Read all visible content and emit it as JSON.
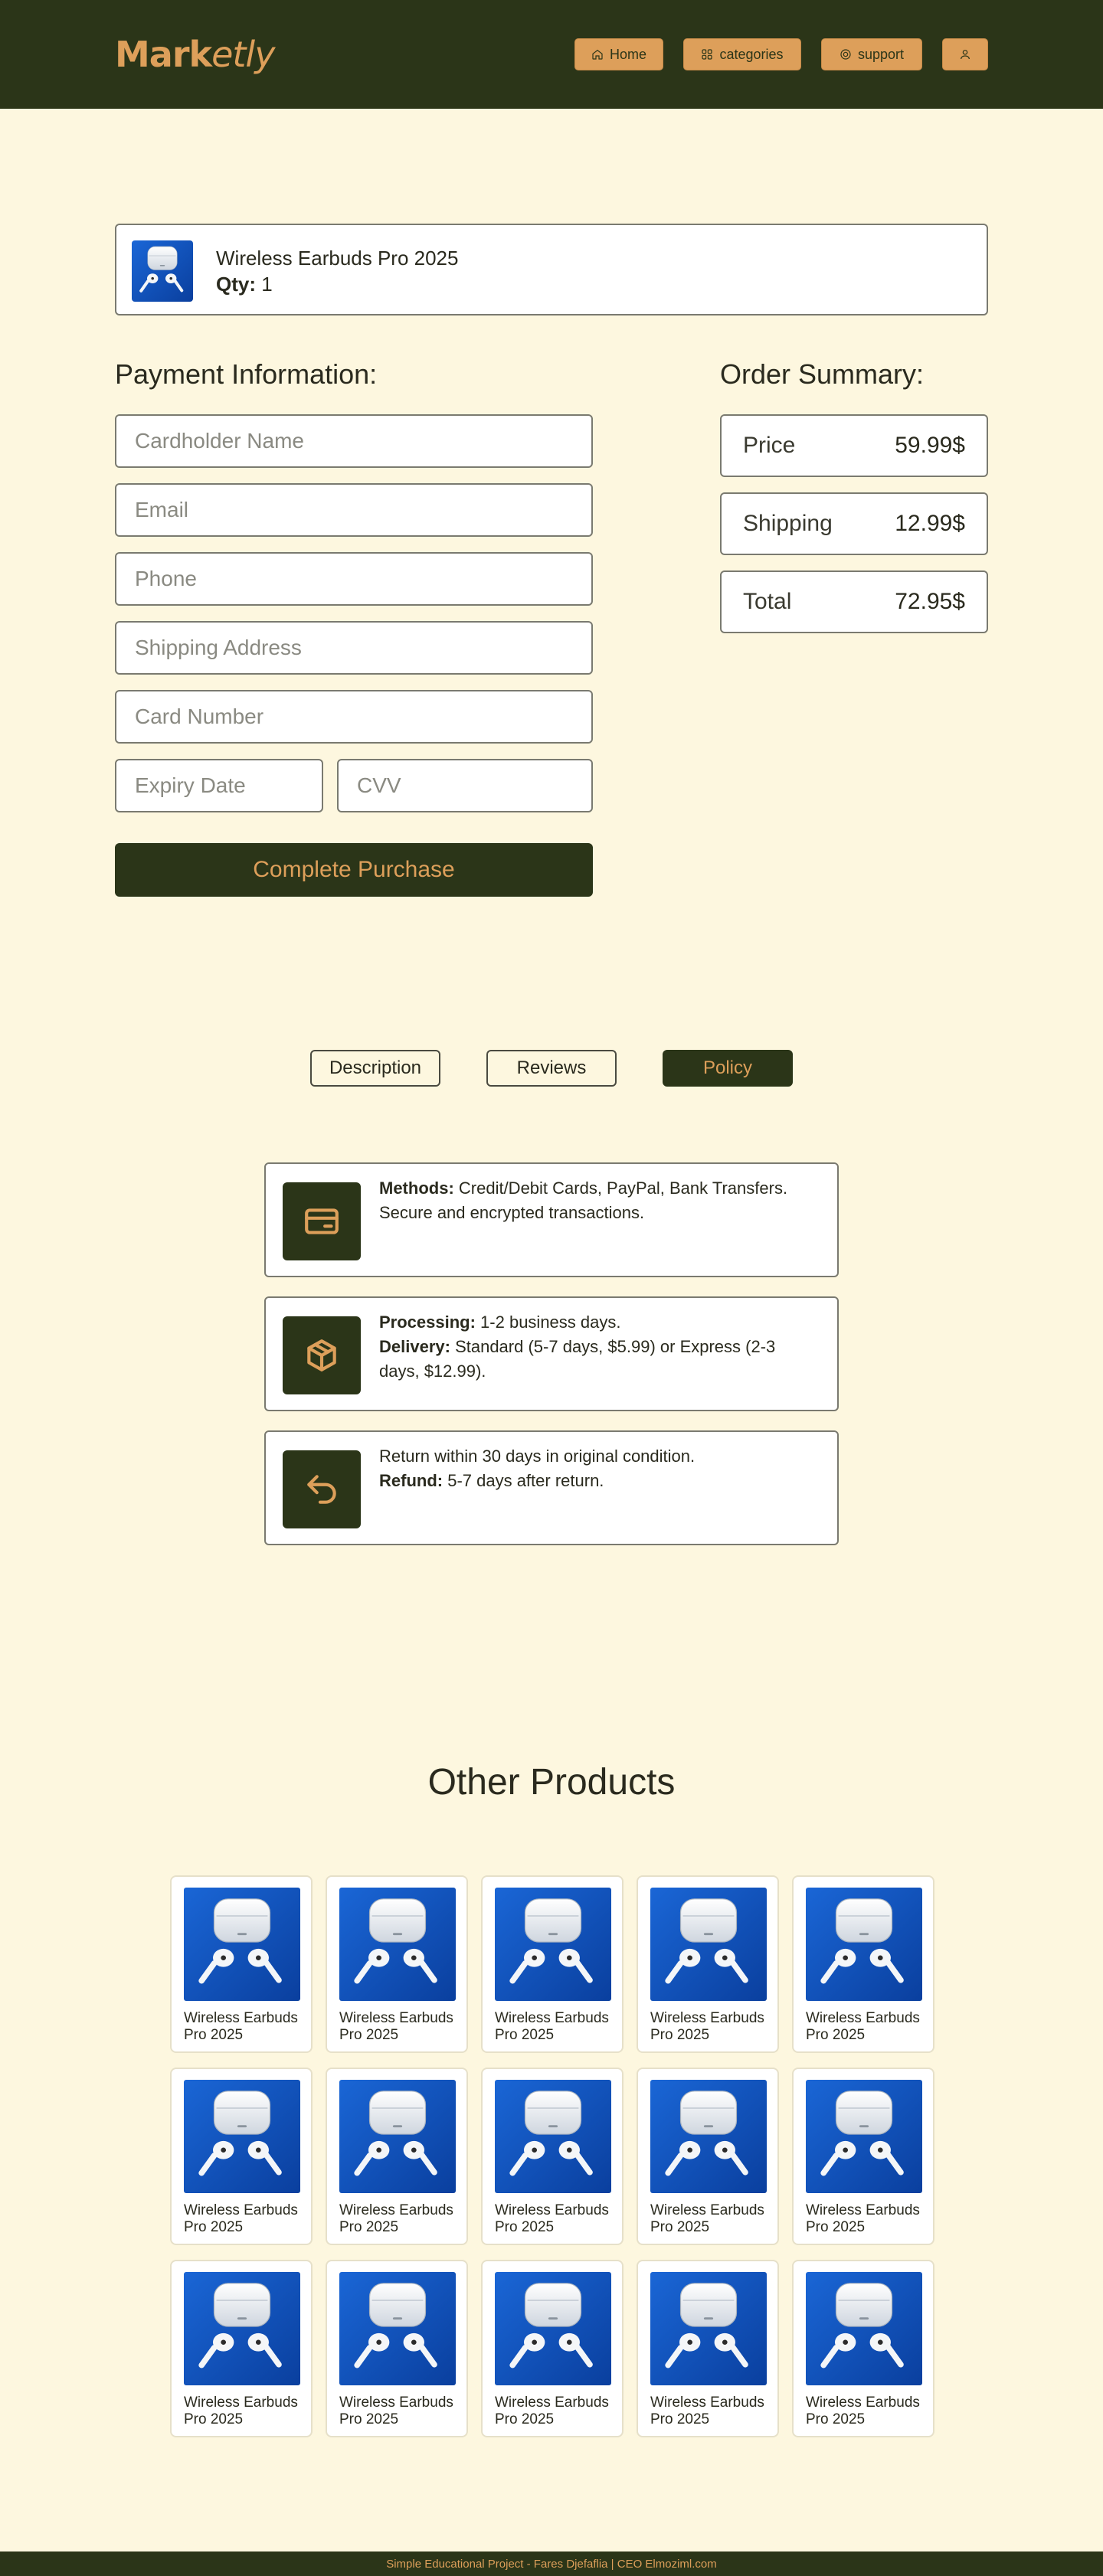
{
  "header": {
    "logo_bold": "Mark",
    "logo_italic": "etly",
    "nav": {
      "home": "Home",
      "categories": "categories",
      "support": "support"
    }
  },
  "cart_item": {
    "name": "Wireless Earbuds Pro 2025",
    "qty_label": "Qty:",
    "qty_value": "1"
  },
  "payment": {
    "title": "Payment Information:",
    "placeholders": {
      "cardholder": "Cardholder Name",
      "email": "Email",
      "phone": "Phone",
      "address": "Shipping Address",
      "card_number": "Card Number",
      "expiry": "Expiry Date",
      "cvv": "CVV"
    },
    "submit": "Complete Purchase"
  },
  "summary": {
    "title": "Order Summary:",
    "rows": [
      {
        "label": "Price",
        "value": "59.99$"
      },
      {
        "label": "Shipping",
        "value": "12.99$"
      },
      {
        "label": "Total",
        "value": "72.95$"
      }
    ]
  },
  "tabs": {
    "items": [
      "Description",
      "Reviews",
      "Policy"
    ],
    "active": "Policy"
  },
  "policy": {
    "card1": {
      "icon": "credit-card-icon",
      "methods_label": "Methods:",
      "methods_text": " Credit/Debit Cards, PayPal, Bank Transfers.",
      "line2": "Secure and encrypted transactions."
    },
    "card2": {
      "icon": "package-icon",
      "processing_label": "Processing:",
      "processing_text": " 1-2 business days.",
      "delivery_label": "Delivery:",
      "delivery_text": " Standard (5-7 days, $5.99) or Express (2-3 days, $12.99)."
    },
    "card3": {
      "icon": "return-arrow-icon",
      "line1": "Return within 30 days in original condition.",
      "refund_label": "Refund:",
      "refund_text": " 5-7 days after return."
    }
  },
  "other_products": {
    "title": "Other Products",
    "items": [
      "Wireless Earbuds Pro 2025",
      "Wireless Earbuds Pro 2025",
      "Wireless Earbuds Pro 2025",
      "Wireless Earbuds Pro 2025",
      "Wireless Earbuds Pro 2025",
      "Wireless Earbuds Pro 2025",
      "Wireless Earbuds Pro 2025",
      "Wireless Earbuds Pro 2025",
      "Wireless Earbuds Pro 2025",
      "Wireless Earbuds Pro 2025",
      "Wireless Earbuds Pro 2025",
      "Wireless Earbuds Pro 2025",
      "Wireless Earbuds Pro 2025",
      "Wireless Earbuds Pro 2025",
      "Wireless Earbuds Pro 2025"
    ]
  },
  "footer": {
    "text": "Simple Educational Project - Fares Djefaflia | CEO Elmoziml.com"
  },
  "colors": {
    "dark_green": "#2b3518",
    "accent_orange": "#dd9f5a",
    "background_cream": "#fdf7df"
  }
}
